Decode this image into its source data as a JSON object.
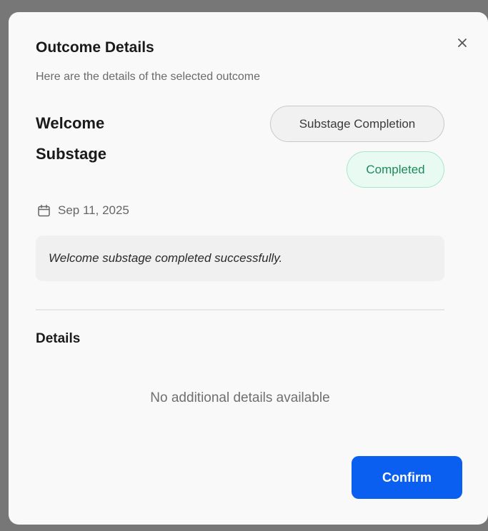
{
  "dialog": {
    "title": "Outcome Details",
    "subtitle": "Here are the details of the selected outcome",
    "close_icon": "close-icon"
  },
  "outcome": {
    "name": "Welcome Substage",
    "type_badge": "Substage Completion",
    "status_badge": "Completed",
    "date_icon": "calendar-icon",
    "date": "Sep 11, 2025",
    "message": "Welcome substage completed successfully."
  },
  "details": {
    "heading": "Details",
    "empty_text": "No additional details available"
  },
  "footer": {
    "confirm_label": "Confirm"
  },
  "colors": {
    "primary": "#0a5ff0",
    "success_text": "#1b8a5a",
    "success_bg": "#e9faf2",
    "success_border": "#a6e7cc"
  }
}
